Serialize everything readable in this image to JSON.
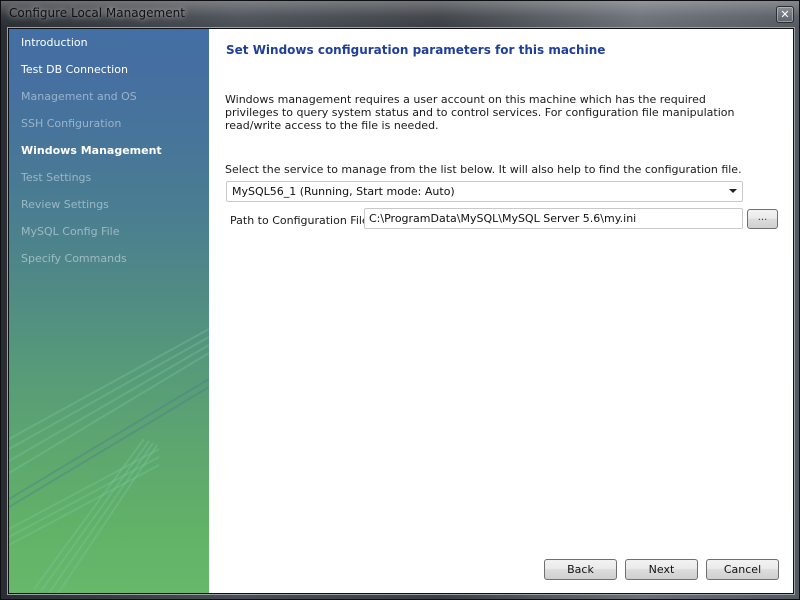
{
  "window": {
    "title": "Configure Local Management",
    "close_icon": "close-icon"
  },
  "sidebar": {
    "items": [
      {
        "label": "Introduction",
        "state": "done"
      },
      {
        "label": "Test DB Connection",
        "state": "done"
      },
      {
        "label": "Management and OS",
        "state": "pending"
      },
      {
        "label": "SSH Configuration",
        "state": "pending"
      },
      {
        "label": "Windows Management",
        "state": "current"
      },
      {
        "label": "Test Settings",
        "state": "pending"
      },
      {
        "label": "Review Settings",
        "state": "pending"
      },
      {
        "label": "MySQL Config File",
        "state": "pending"
      },
      {
        "label": "Specify Commands",
        "state": "pending"
      }
    ]
  },
  "main": {
    "title": "Set Windows configuration parameters for this machine",
    "description": "Windows management requires a user account on this machine which has the required privileges to query system status and to control services. For configuration file manipulation read/write access to the file is needed.",
    "select_label": "Select the service to manage from the list below. It will also help to find the configuration file.",
    "service_selected": "MySQL56_1 (Running, Start mode: Auto)",
    "path_label": "Path to Configuration File:",
    "path_value": "C:\\ProgramData\\MySQL\\MySQL Server 5.6\\my.ini",
    "browse_label": "..."
  },
  "footer": {
    "back_label": "Back",
    "next_label": "Next",
    "cancel_label": "Cancel"
  },
  "colors": {
    "title_blue": "#1f3f99",
    "sidebar_top": "#446fa4",
    "sidebar_bottom": "#66b86a"
  }
}
